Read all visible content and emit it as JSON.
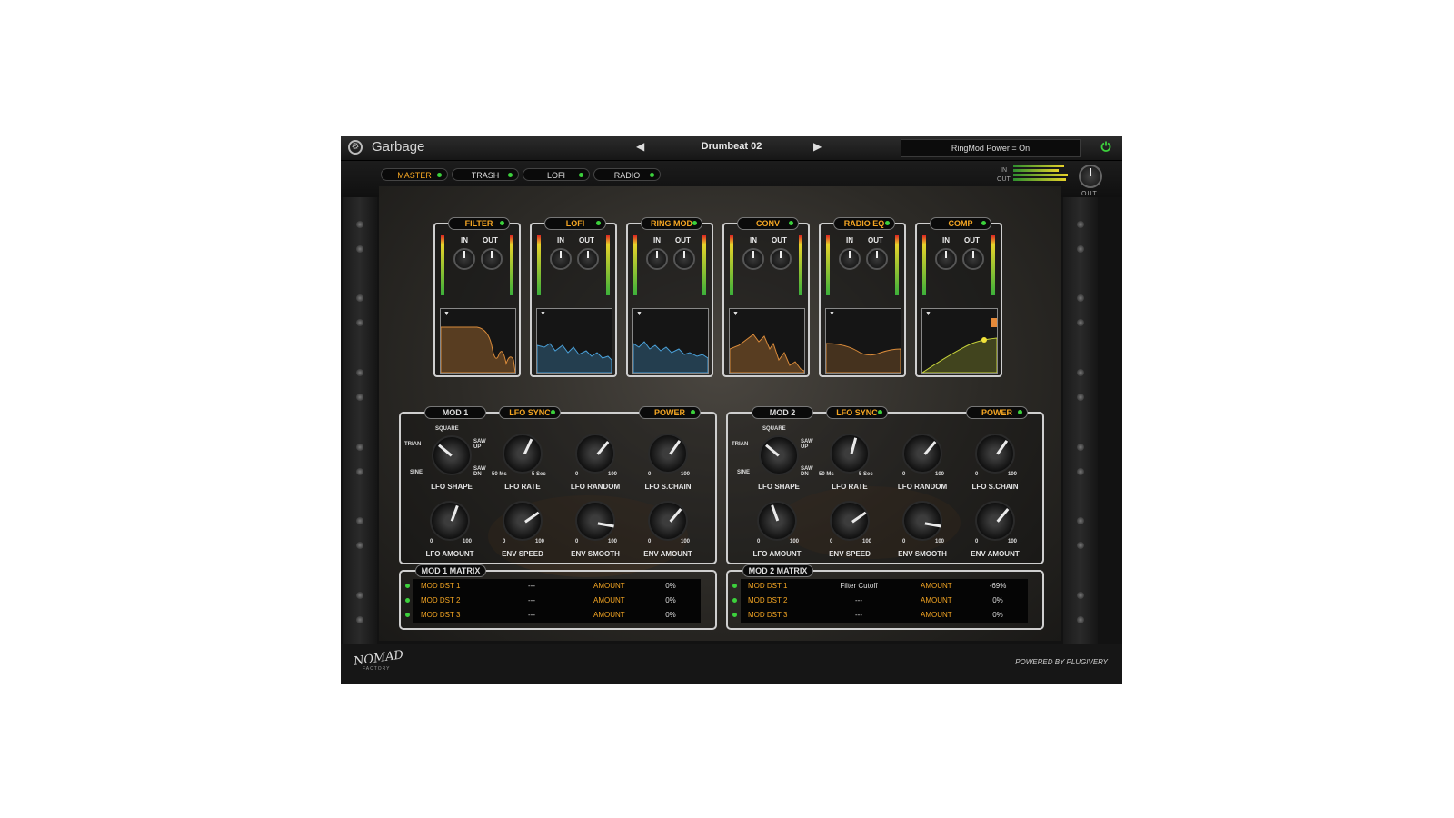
{
  "app": {
    "title": "Garbage"
  },
  "preset": {
    "name": "Drumbeat 02",
    "prev_arrow": "◀",
    "next_arrow": "▶"
  },
  "status": {
    "text": "RingMod Power = On"
  },
  "tabs": [
    {
      "label": "MASTER",
      "active": true
    },
    {
      "label": "TRASH",
      "active": false
    },
    {
      "label": "LOFI",
      "active": false
    },
    {
      "label": "RADIO",
      "active": false
    }
  ],
  "io": {
    "in_label": "IN",
    "out_label": "OUT",
    "out_knob_label": "OUT"
  },
  "modules": [
    {
      "name": "FILTER",
      "in_label": "IN",
      "out_label": "OUT",
      "graph_color": "#d88a3a"
    },
    {
      "name": "LOFI",
      "in_label": "IN",
      "out_label": "OUT",
      "graph_color": "#4aa0d8"
    },
    {
      "name": "RING MOD",
      "in_label": "IN",
      "out_label": "OUT",
      "graph_color": "#4aa0d8"
    },
    {
      "name": "CONV",
      "in_label": "IN",
      "out_label": "OUT",
      "graph_color": "#d88a3a"
    },
    {
      "name": "RADIO EQ",
      "in_label": "IN",
      "out_label": "OUT",
      "graph_color": "#d88a3a"
    },
    {
      "name": "COMP",
      "in_label": "IN",
      "out_label": "OUT",
      "graph_color": "#c8d43a"
    }
  ],
  "mods": [
    {
      "title": "MOD 1",
      "lfo_sync": "LFO SYNC",
      "power": "POWER",
      "shape_ticks": {
        "square": "SQUARE",
        "trian": "TRIAN",
        "saw_up": "SAW UP",
        "sine": "SINE",
        "saw_dn": "SAW DN"
      },
      "knobs_row1": [
        {
          "label": "LFO SHAPE",
          "min": "",
          "max": ""
        },
        {
          "label": "LFO RATE",
          "min": "50 Ms",
          "max": "5 Sec"
        },
        {
          "label": "LFO RANDOM",
          "min": "0",
          "max": "100"
        },
        {
          "label": "LFO S.CHAIN",
          "min": "0",
          "max": "100"
        }
      ],
      "knobs_row2": [
        {
          "label": "LFO AMOUNT",
          "min": "0",
          "max": "100"
        },
        {
          "label": "ENV SPEED",
          "min": "0",
          "max": "100"
        },
        {
          "label": "ENV SMOOTH",
          "min": "0",
          "max": "100"
        },
        {
          "label": "ENV AMOUNT",
          "min": "0",
          "max": "100"
        }
      ],
      "matrix_title": "MOD 1 MATRIX",
      "matrix": [
        {
          "dst": "MOD DST 1",
          "value": "---",
          "amount_label": "AMOUNT",
          "amount": "0%"
        },
        {
          "dst": "MOD DST 2",
          "value": "---",
          "amount_label": "AMOUNT",
          "amount": "0%"
        },
        {
          "dst": "MOD DST 3",
          "value": "---",
          "amount_label": "AMOUNT",
          "amount": "0%"
        }
      ]
    },
    {
      "title": "MOD 2",
      "lfo_sync": "LFO SYNC",
      "power": "POWER",
      "shape_ticks": {
        "square": "SQUARE",
        "trian": "TRIAN",
        "saw_up": "SAW UP",
        "sine": "SINE",
        "saw_dn": "SAW DN"
      },
      "knobs_row1": [
        {
          "label": "LFO SHAPE",
          "min": "",
          "max": ""
        },
        {
          "label": "LFO RATE",
          "min": "50 Ms",
          "max": "5 Sec"
        },
        {
          "label": "LFO RANDOM",
          "min": "0",
          "max": "100"
        },
        {
          "label": "LFO S.CHAIN",
          "min": "0",
          "max": "100"
        }
      ],
      "knobs_row2": [
        {
          "label": "LFO AMOUNT",
          "min": "0",
          "max": "100"
        },
        {
          "label": "ENV SPEED",
          "min": "0",
          "max": "100"
        },
        {
          "label": "ENV SMOOTH",
          "min": "0",
          "max": "100"
        },
        {
          "label": "ENV AMOUNT",
          "min": "0",
          "max": "100"
        }
      ],
      "matrix_title": "MOD 2 MATRIX",
      "matrix": [
        {
          "dst": "MOD DST 1",
          "value": "Filter Cutoff",
          "amount_label": "AMOUNT",
          "amount": "-69%"
        },
        {
          "dst": "MOD DST 2",
          "value": "---",
          "amount_label": "AMOUNT",
          "amount": "0%"
        },
        {
          "dst": "MOD DST 3",
          "value": "---",
          "amount_label": "AMOUNT",
          "amount": "0%"
        }
      ]
    }
  ],
  "footer": {
    "brand": "NOMAD",
    "brand_sub": "FACTORY",
    "powered": "POWERED BY PLUGIVERY"
  },
  "colors": {
    "accent": "#f5a623",
    "led": "#3cd13c"
  }
}
